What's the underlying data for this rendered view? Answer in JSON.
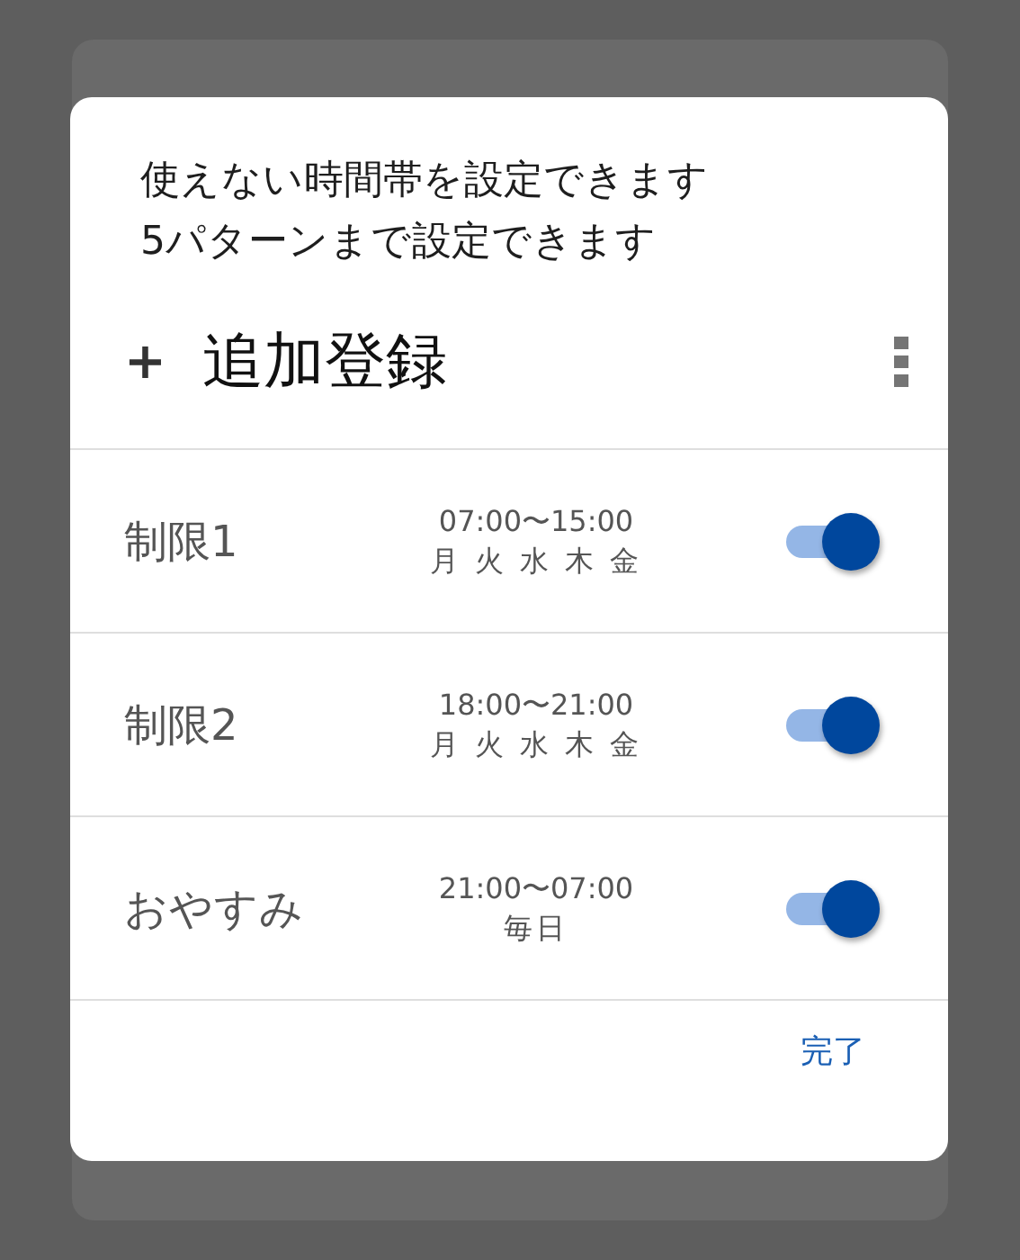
{
  "description": [
    "使えない時間帯を設定できます",
    "5パターンまで設定できます"
  ],
  "add": {
    "icon": "+",
    "label": "追加登録"
  },
  "restrictions": [
    {
      "name": "制限1",
      "time": "07:00〜15:00",
      "days": "月 火 水 木 金",
      "on": true
    },
    {
      "name": "制限2",
      "time": "18:00〜21:00",
      "days": "月 火 水 木 金",
      "on": true
    },
    {
      "name": "おやすみ",
      "time": "21:00〜07:00",
      "days": "毎日",
      "on": true
    }
  ],
  "done_button": "完了"
}
